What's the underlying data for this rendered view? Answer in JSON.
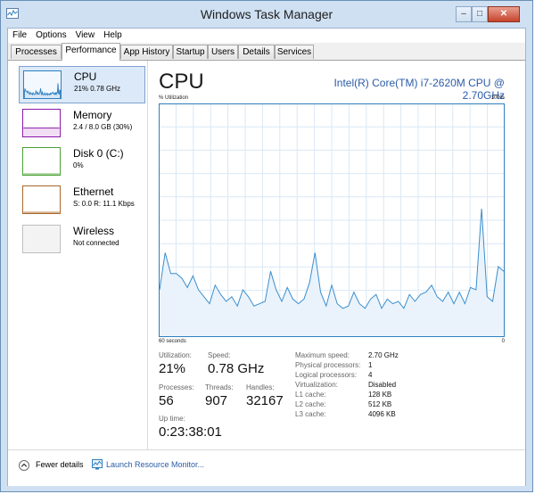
{
  "window": {
    "title": "Windows Task Manager"
  },
  "menu": [
    "File",
    "Options",
    "View",
    "Help"
  ],
  "tabs": [
    "Processes",
    "Performance",
    "App History",
    "Startup",
    "Users",
    "Details",
    "Services"
  ],
  "sidebar": {
    "items": [
      {
        "name": "CPU",
        "detail": "21%  0.78 GHz",
        "color": "#2f7fbf"
      },
      {
        "name": "Memory",
        "detail": "2.4 / 8.0 GB (30%)",
        "color": "#8b18a8"
      },
      {
        "name": "Disk 0 (C:)",
        "detail": "0%",
        "color": "#4aa034"
      },
      {
        "name": "Ethernet",
        "detail": "S: 0.0  R: 11.1 Kbps",
        "color": "#a8652a"
      },
      {
        "name": "Wireless",
        "detail": "Not connected",
        "color": "#bdbdbd"
      }
    ]
  },
  "main": {
    "title": "CPU",
    "model": "Intel(R) Core(TM) i7-2620M CPU @ 2.70GHz",
    "graph_label_left": "% Utilization",
    "graph_label_right": "100%",
    "time_left": "60 seconds",
    "time_right": "0"
  },
  "stats": {
    "utilization_label": "Utilization:",
    "utilization": "21%",
    "speed_label": "Speed:",
    "speed": "0.78 GHz",
    "processes_label": "Processes:",
    "processes": "56",
    "threads_label": "Threads:",
    "threads": "907",
    "handles_label": "Handles:",
    "handles": "32167",
    "uptime_label": "Up time:",
    "uptime": "0:23:38:01"
  },
  "specs": [
    {
      "label": "Maximum speed:",
      "value": "2.70 GHz"
    },
    {
      "label": "Physical processors:",
      "value": "1"
    },
    {
      "label": "Logical processors:",
      "value": "4"
    },
    {
      "label": "Virtualization:",
      "value": "Disabled"
    },
    {
      "label": "L1 cache:",
      "value": "128 KB"
    },
    {
      "label": "L2 cache:",
      "value": "512 KB"
    },
    {
      "label": "L3 cache:",
      "value": "4096 KB"
    }
  ],
  "footer": {
    "fewer_details": "Fewer details",
    "launch_monitor": "Launch Resource Monitor..."
  },
  "cpu_history": [
    20,
    36,
    27,
    27,
    25,
    21,
    26,
    20,
    17,
    14,
    22,
    18,
    15,
    17,
    13,
    20,
    17,
    13,
    14,
    15,
    28,
    20,
    15,
    21,
    16,
    14,
    16,
    23,
    36,
    19,
    13,
    22,
    14,
    12,
    13,
    19,
    14,
    12,
    16,
    18,
    12,
    16,
    14,
    15,
    12,
    18,
    15,
    18,
    19,
    22,
    17,
    15,
    19,
    14,
    19,
    14,
    21,
    20,
    55,
    17,
    15,
    30,
    28
  ]
}
